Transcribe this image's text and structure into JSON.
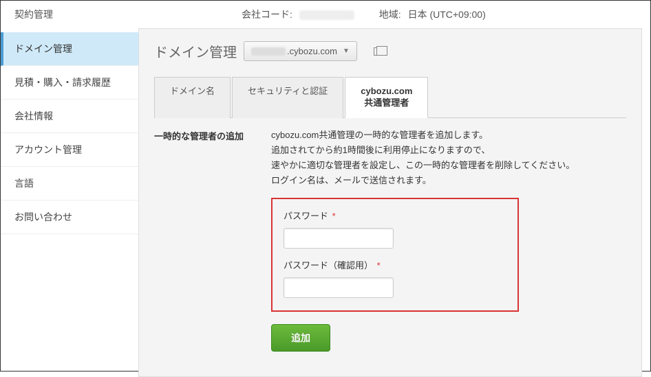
{
  "header": {
    "contract_label": "契約管理",
    "company_code_label": "会社コード:",
    "region_label": "地域:",
    "region_value": "日本 (UTC+09:00)"
  },
  "sidebar": {
    "items": [
      {
        "label": "ドメイン管理"
      },
      {
        "label": "見積・購入・請求履歴"
      },
      {
        "label": "会社情報"
      },
      {
        "label": "アカウント管理"
      },
      {
        "label": "言語"
      },
      {
        "label": "お問い合わせ"
      }
    ]
  },
  "main": {
    "title": "ドメイン管理",
    "domain_suffix": ".cybozu.com",
    "tabs": [
      {
        "label": "ドメイン名"
      },
      {
        "label": "セキュリティと認証"
      },
      {
        "label_line1": "cybozu.com",
        "label_line2": "共通管理者"
      }
    ],
    "section_title": "一時的な管理者の追加",
    "desc_line1": "cybozu.com共通管理の一時的な管理者を追加します。",
    "desc_line2": "追加されてから約1時間後に利用停止になりますので、",
    "desc_line3": "速やかに適切な管理者を設定し、この一時的な管理者を削除してください。",
    "desc_line4": "ログイン名は、メールで送信されます。",
    "password_label": "パスワード",
    "password_confirm_label": "パスワード（確認用）",
    "required_mark": "*",
    "submit_label": "追加"
  }
}
